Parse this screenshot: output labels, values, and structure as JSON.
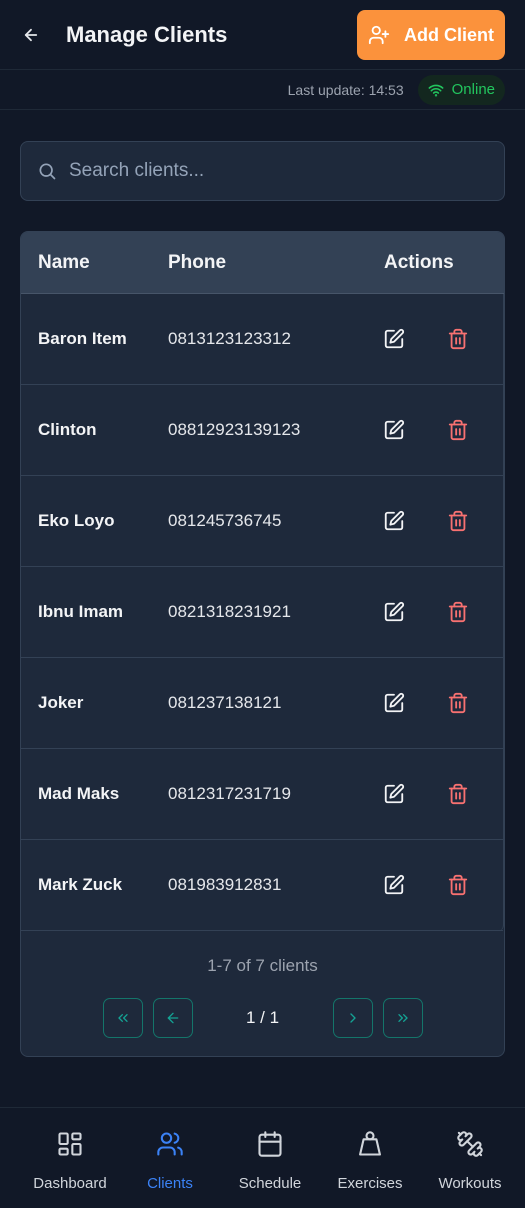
{
  "header": {
    "title": "Manage Clients",
    "add_button_label": "Add Client"
  },
  "status": {
    "last_update": "Last update: 14:53",
    "online_label": "Online"
  },
  "search": {
    "placeholder": "Search clients..."
  },
  "table": {
    "columns": [
      "Name",
      "Phone",
      "Actions"
    ],
    "rows": [
      {
        "name": "Baron Item",
        "phone": "0813123123312"
      },
      {
        "name": "Clinton",
        "phone": "08812923139123"
      },
      {
        "name": "Eko Loyo",
        "phone": "081245736745"
      },
      {
        "name": "Ibnu Imam",
        "phone": "0821318231921"
      },
      {
        "name": "Joker",
        "phone": "081237138121"
      },
      {
        "name": "Mad Maks",
        "phone": "0812317231719"
      },
      {
        "name": "Mark Zuck",
        "phone": "081983912831"
      }
    ]
  },
  "pagination": {
    "summary": "1-7 of 7 clients",
    "page": "1 / 1"
  },
  "nav": {
    "items": [
      {
        "label": "Dashboard",
        "icon": "dashboard-icon"
      },
      {
        "label": "Clients",
        "icon": "users-icon",
        "active": true
      },
      {
        "label": "Schedule",
        "icon": "calendar-icon"
      },
      {
        "label": "Exercises",
        "icon": "weight-icon"
      },
      {
        "label": "Workouts",
        "icon": "dumbbell-icon"
      }
    ]
  },
  "colors": {
    "accent": "#fb923c",
    "active_nav": "#3b82f6",
    "delete": "#f87171",
    "online": "#22c55e",
    "pager": "#14a394"
  }
}
